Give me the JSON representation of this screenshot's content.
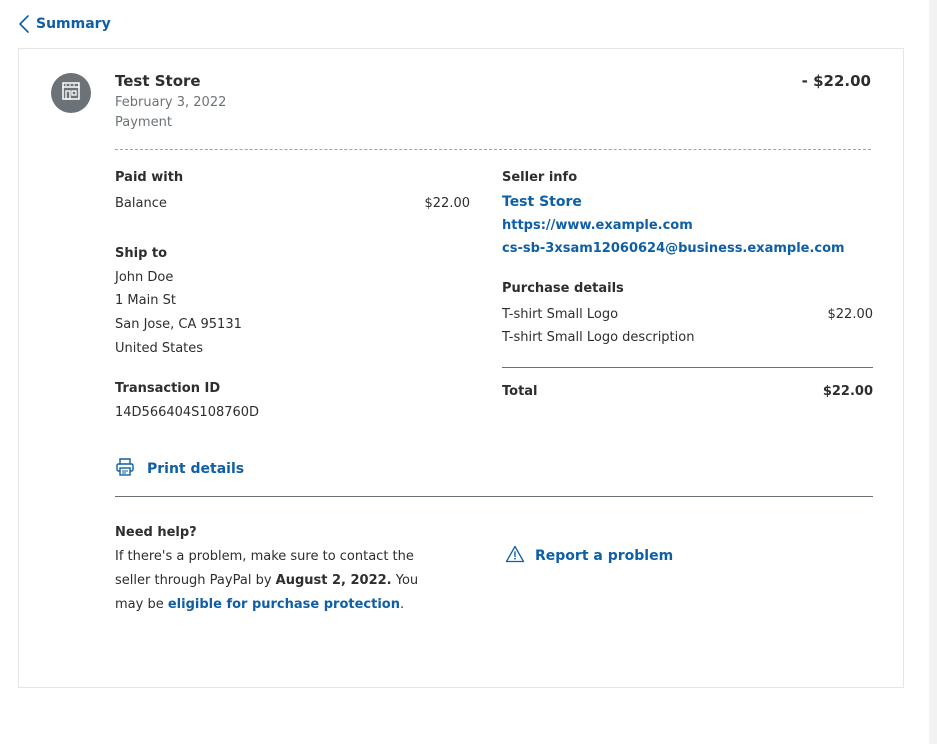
{
  "nav": {
    "back_label": "Summary"
  },
  "transaction": {
    "merchant": "Test Store",
    "date": "February 3, 2022",
    "type": "Payment",
    "amount": "- $22.00"
  },
  "paid_with": {
    "label": "Paid with",
    "method": "Balance",
    "amount": "$22.00"
  },
  "ship_to": {
    "label": "Ship to",
    "name": "John Doe",
    "street": "1 Main St",
    "city": "San Jose, CA 95131",
    "country": "United States"
  },
  "transaction_id": {
    "label": "Transaction ID",
    "value": "14D566404S108760D"
  },
  "print": {
    "label": "Print details"
  },
  "seller_info": {
    "label": "Seller info",
    "name": "Test Store",
    "website": "https://www.example.com",
    "email": "cs-sb-3xsam12060624@business.example.com"
  },
  "purchase_details": {
    "label": "Purchase details",
    "item_name": "T-shirt Small Logo",
    "item_price": "$22.00",
    "item_description": "T-shirt Small Logo description",
    "total_label": "Total",
    "total_value": "$22.00"
  },
  "help": {
    "title": "Need help?",
    "text_before": "If there's a problem, make sure to contact the seller through PayPal by ",
    "deadline": "August 2, 2022.",
    "text_middle": " You may be ",
    "protection_link": "eligible for purchase protection",
    "text_end": "."
  },
  "report": {
    "label": "Report a problem"
  },
  "colors": {
    "link": "#0f5fa6",
    "text": "#2c2e2f",
    "muted": "#6c7378"
  },
  "icons": [
    "chevron-left-icon",
    "store-icon",
    "printer-icon",
    "warning-icon"
  ]
}
